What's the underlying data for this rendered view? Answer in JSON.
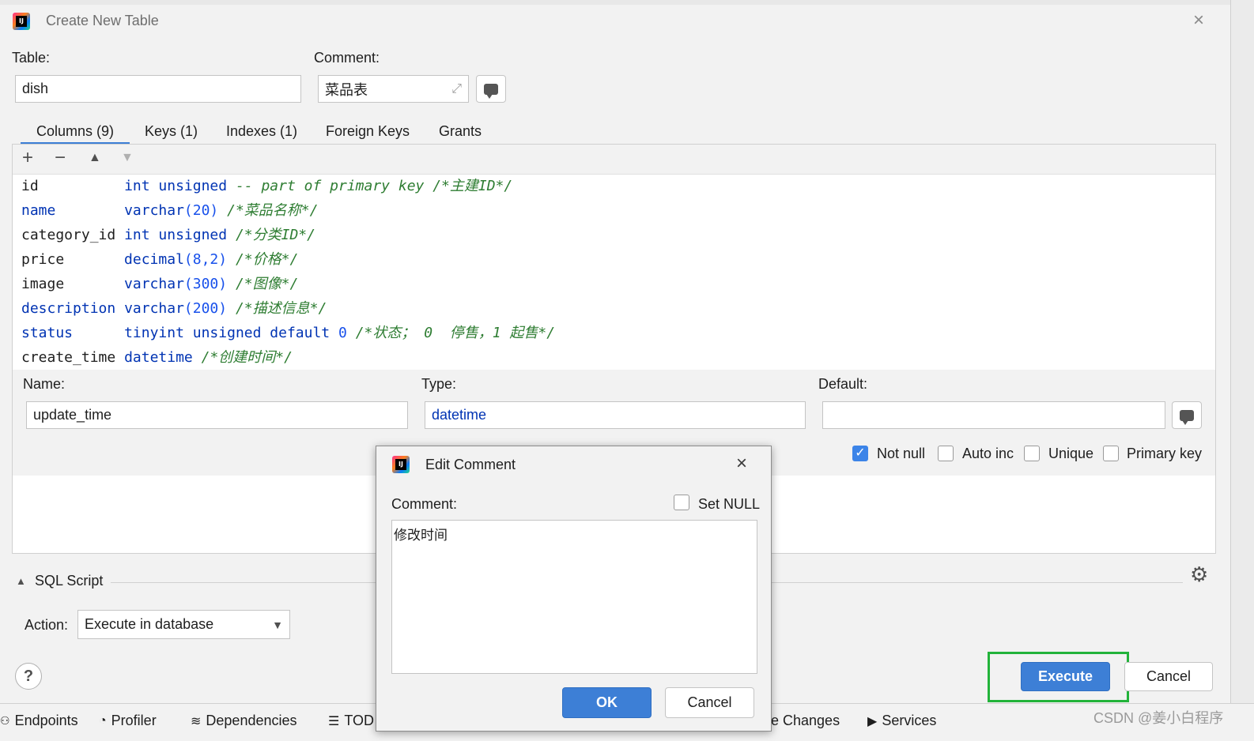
{
  "window": {
    "title": "Create New Table"
  },
  "table_form": {
    "table_label": "Table:",
    "table_value": "dish",
    "comment_label": "Comment:",
    "comment_value": "菜品表"
  },
  "tabs": [
    {
      "label": "Columns (9)",
      "active": true
    },
    {
      "label": "Keys (1)"
    },
    {
      "label": "Indexes (1)"
    },
    {
      "label": "Foreign Keys"
    },
    {
      "label": "Grants"
    }
  ],
  "columns": [
    {
      "name": "id",
      "def_type": "int unsigned",
      "def_comment": "-- part of primary key /*主建ID*/"
    },
    {
      "name": "name",
      "def_type_kw": "varchar",
      "def_args": "(20)",
      "def_comment": "/*菜品名称*/"
    },
    {
      "name": "category_id",
      "def_type": "int unsigned",
      "def_comment": "/*分类ID*/"
    },
    {
      "name": "price",
      "def_type_kw": "decimal",
      "def_args": "(8,2)",
      "def_comment": "/*价格*/"
    },
    {
      "name": "image",
      "def_type_kw": "varchar",
      "def_args": "(300)",
      "def_comment": "/*图像*/"
    },
    {
      "name": "description",
      "def_type_kw": "varchar",
      "def_args": "(200)",
      "def_comment": "/*描述信息*/"
    },
    {
      "name": "status",
      "def_type": "tinyint unsigned default",
      "def_num": "0",
      "def_comment": "/*状态； 0  停售，1 起售*/"
    },
    {
      "name": "create_time",
      "def_type": "datetime",
      "def_comment": "/*创建时间*/"
    }
  ],
  "column_editor": {
    "name_label": "Name:",
    "name_value": "update_time",
    "type_label": "Type:",
    "type_value": "datetime",
    "default_label": "Default:",
    "default_value": "",
    "checkboxes": [
      {
        "label": "Not null",
        "checked": true
      },
      {
        "label": "Auto inc",
        "checked": false
      },
      {
        "label": "Unique",
        "checked": false
      },
      {
        "label": "Primary key",
        "checked": false
      }
    ]
  },
  "sql_script": {
    "label": "SQL Script",
    "action_label": "Action:",
    "action_value": "Execute in database"
  },
  "buttons": {
    "execute": "Execute",
    "cancel": "Cancel",
    "help": "?"
  },
  "edit_comment_modal": {
    "title": "Edit Comment",
    "comment_label": "Comment:",
    "set_null_label": "Set NULL",
    "set_null_checked": false,
    "comment_text": "修改时间",
    "ok": "OK",
    "cancel": "Cancel"
  },
  "bottom_toolbar": [
    {
      "label": "Endpoints",
      "icon": "endpoints-icon"
    },
    {
      "label": "Profiler",
      "icon": "profiler-icon"
    },
    {
      "label": "Dependencies",
      "icon": "dependencies-icon"
    },
    {
      "label": "TOD",
      "icon": "todo-icon"
    },
    {
      "label": "e Changes",
      "icon": ""
    },
    {
      "label": "Services",
      "icon": "services-icon"
    }
  ],
  "watermark": "CSDN @姜小白程序",
  "colors": {
    "accent": "#3d7fd6",
    "highlight_box": "#22b33a",
    "keyword": "#0033b3",
    "comment": "#2e7d32"
  }
}
